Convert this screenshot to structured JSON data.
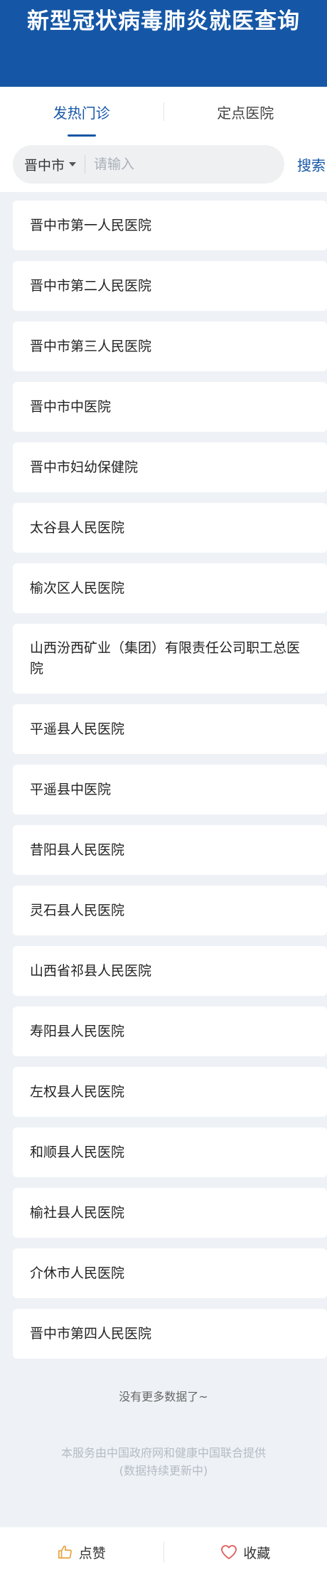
{
  "header": {
    "title": "新型冠状病毒肺炎就医查询"
  },
  "tabs": [
    {
      "label": "发热门诊",
      "active": true
    },
    {
      "label": "定点医院",
      "active": false
    }
  ],
  "search": {
    "city": "晋中市",
    "placeholder": "请输入",
    "value": "",
    "button_label": "搜索"
  },
  "hospitals": [
    "晋中市第一人民医院",
    "晋中市第二人民医院",
    "晋中市第三人民医院",
    "晋中市中医院",
    "晋中市妇幼保健院",
    "太谷县人民医院",
    "榆次区人民医院",
    "山西汾西矿业（集团）有限责任公司职工总医院",
    "平遥县人民医院",
    "平遥县中医院",
    "昔阳县人民医院",
    "灵石县人民医院",
    "山西省祁县人民医院",
    "寿阳县人民医院",
    "左权县人民医院",
    "和顺县人民医院",
    "榆社县人民医院",
    "介休市人民医院",
    "晋中市第四人民医院"
  ],
  "list_end_text": "没有更多数据了~",
  "footer": {
    "line1": "本服务由中国政府网和健康中国联合提供",
    "line2": "(数据持续更新中)"
  },
  "bottom_bar": {
    "like_label": "点赞",
    "favorite_label": "收藏"
  },
  "colors": {
    "brand": "#1557a6",
    "like_icon": "#e6a23c",
    "favorite_icon": "#e05a5a"
  },
  "icons": {
    "like": "thumbs-up-icon",
    "favorite": "heart-icon",
    "dropdown": "caret-down-icon"
  }
}
